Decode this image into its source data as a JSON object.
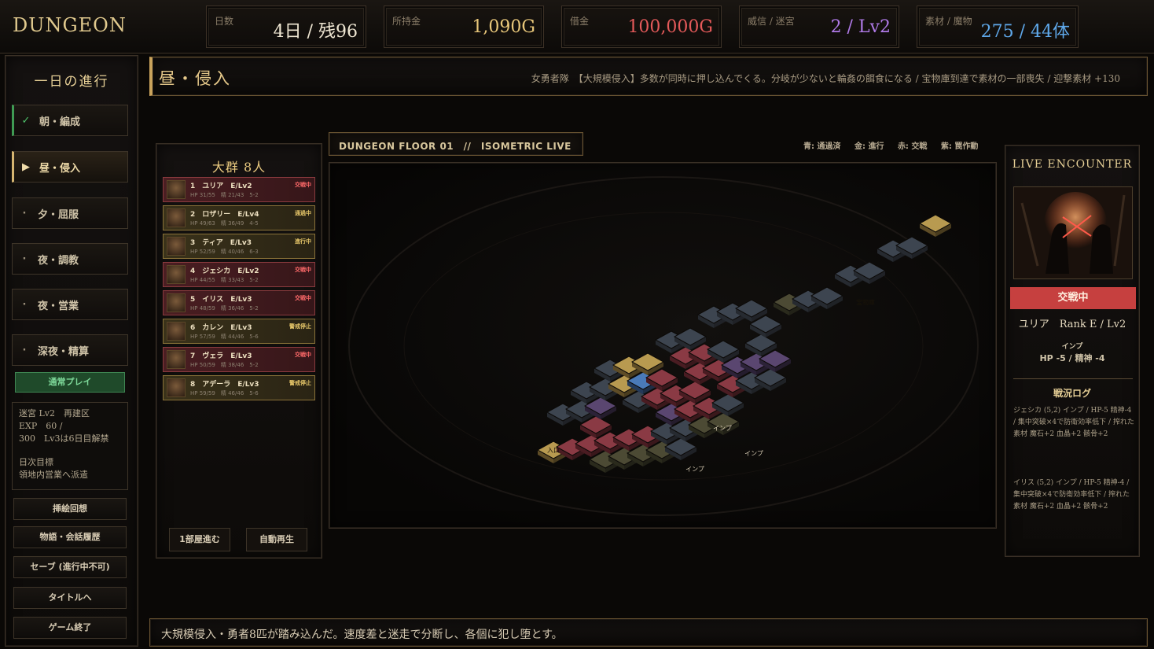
{
  "header": {
    "logo": "DUNGEON",
    "stats": [
      {
        "label": "日数",
        "value": "4日 / 残96",
        "color": "#efe6d2"
      },
      {
        "label": "所持金",
        "value": "1,090G",
        "color": "#e8c77a"
      },
      {
        "label": "借金",
        "value": "100,000G",
        "color": "#e55a5a"
      },
      {
        "label": "威信 / 迷宮",
        "value": "2 / Lv2",
        "color": "#b07ae8"
      },
      {
        "label": "素材 / 魔物",
        "value": "275 / 44体",
        "color": "#5fa8ea"
      }
    ]
  },
  "nav": {
    "title": "一日の進行",
    "items": [
      {
        "label": "朝・編成",
        "mark": "✓",
        "state": "done"
      },
      {
        "label": "昼・侵入",
        "mark": "▶",
        "state": "active"
      },
      {
        "label": "夕・屈服",
        "mark": "·",
        "state": "pending"
      },
      {
        "label": "夜・調教",
        "mark": "·",
        "state": "pending"
      },
      {
        "label": "夜・営業",
        "mark": "·",
        "state": "pending"
      },
      {
        "label": "深夜・精算",
        "mark": "·",
        "state": "pending"
      }
    ],
    "mode": "通常プレイ",
    "info": {
      "line1": "迷宮 Lv2　再建区",
      "line2": "EXP　60 /",
      "line3": "300　Lv3は6日目解禁",
      "line4": "日次目標",
      "line5": "領地内営業へ派遣"
    },
    "buttons": [
      "挿絵回想",
      "物語・会話履歴",
      "セーブ (進行中不可)",
      "タイトルへ",
      "ゲーム終了"
    ]
  },
  "phase": {
    "title": "昼・侵入",
    "description": "女勇者隊　【大規模侵入】多数が同時に押し込んでくる。分岐が少ないと輪姦の餌食になる / 宝物庫到達で素材の一部喪失 / 迎撃素材 +130"
  },
  "squad": {
    "title": "大群 8人",
    "heroes": [
      {
        "name": "1　ユリア　E/Lv2",
        "stats": "HP 31/55　精 21/43　5-2",
        "status": "交戦中",
        "tone": "red"
      },
      {
        "name": "2　ロザリー　E/Lv4",
        "stats": "HP 49/63　精 36/49　4-5",
        "status": "通過中",
        "tone": "gold"
      },
      {
        "name": "3　ティア　E/Lv3",
        "stats": "HP 52/59　精 40/46　6-3",
        "status": "進行中",
        "tone": "gold"
      },
      {
        "name": "4　ジェシカ　E/Lv2",
        "stats": "HP 44/55　精 33/43　5-2",
        "status": "交戦中",
        "tone": "red"
      },
      {
        "name": "5　イリス　E/Lv3",
        "stats": "HP 48/59　精 36/46　5-2",
        "status": "交戦中",
        "tone": "red"
      },
      {
        "name": "6　カレン　E/Lv3",
        "stats": "HP 57/59　精 44/46　5-6",
        "status": "警戒停止",
        "tone": "gold"
      },
      {
        "name": "7　ヴェラ　E/Lv3",
        "stats": "HP 50/59　精 38/46　5-2",
        "status": "交戦中",
        "tone": "red"
      },
      {
        "name": "8　アデーラ　E/Lv3",
        "stats": "HP 59/59　精 46/46　5-6",
        "status": "警戒停止",
        "tone": "gold"
      }
    ],
    "step_button": "1部屋進む",
    "auto_button": "自動再生"
  },
  "map": {
    "tab_label": "DUNGEON FLOOR 01　//　ISOMETRIC LIVE",
    "legend": [
      "青: 通過済",
      "金: 進行",
      "赤: 交戦",
      "紫: 罠作動"
    ],
    "entrance_label": "入口",
    "treasure_label": "宝物庫",
    "monster_label": "インプ"
  },
  "encounter": {
    "title": "LIVE ENCOUNTER",
    "status": "交戦中",
    "hero": "ユリア　Rank E / Lv2",
    "enemy": "インプ",
    "damage": "HP -5 / 精神 -4",
    "log_title": "戦況ログ",
    "logs": [
      "ジェシカ (5,2) インプ / HP-5 精神-4 / 集中突破×4で防衛効率低下 / 搾れた素材 魔石+2 血晶+2 骸骨+2",
      "イリス (5,2) インプ / HP-5 精神-4 / 集中突破×4で防衛効率低下 / 搾れた素材 魔石+2 血晶+2 骸骨+2"
    ]
  },
  "message": "大規模侵入・勇者8匹が踏み込んだ。速度差と迷走で分断し、各個に犯し堕とす。"
}
